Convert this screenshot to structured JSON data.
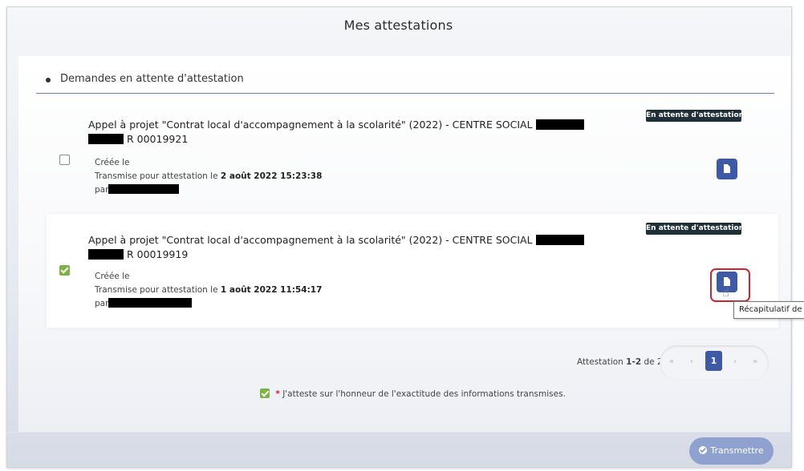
{
  "page": {
    "title": "Mes attestations"
  },
  "section": {
    "title": "Demandes en attente d'attestation"
  },
  "items": [
    {
      "title_line1": "Appel à projet \"Contrat local d'accompagnement à la scolarité\" (2022) - CENTRE SOCIAL",
      "title_line2_suffix": "R 00019921",
      "checked": false,
      "created_label": "Créée le",
      "transmitted_prefix": "Transmise pour attestation le",
      "transmitted_date": "2 août 2022 15:23:38",
      "by_label": "par",
      "status_badge": "En attente d'attestation"
    },
    {
      "title_line1": "Appel à projet \"Contrat local d'accompagnement à la scolarité\" (2022) - CENTRE SOCIAL",
      "title_line2_suffix": "R 00019919",
      "checked": true,
      "created_label": "Créée le",
      "transmitted_prefix": "Transmise pour attestation le",
      "transmitted_date": "1 août 2022 11:54:17",
      "by_label": "par",
      "status_badge": "En attente d'attestation"
    }
  ],
  "tooltip": {
    "text": "Récapitulatif de"
  },
  "pagination": {
    "label_prefix": "Attestation",
    "range": "1-2",
    "label_of": "de 2",
    "first": "«",
    "prev": "‹",
    "current": "1",
    "next": "›",
    "last": "»"
  },
  "attestation": {
    "required_mark": "*",
    "text": "J'atteste sur l'honneur de l'exactitude des informations transmises.",
    "checked": true
  },
  "actions": {
    "submit_label": "Transmettre"
  },
  "colors": {
    "primary": "#3e5aa5",
    "badge_bg": "#1f2f38",
    "check_green": "#7cb342",
    "highlight_red": "#d2232a",
    "submit_disabled": "#8fa2cf"
  },
  "icons": {
    "document": "document-icon",
    "checkbox": "checkbox-icon",
    "hand_cursor": "hand-cursor-icon",
    "check_circle": "check-circle-icon"
  }
}
